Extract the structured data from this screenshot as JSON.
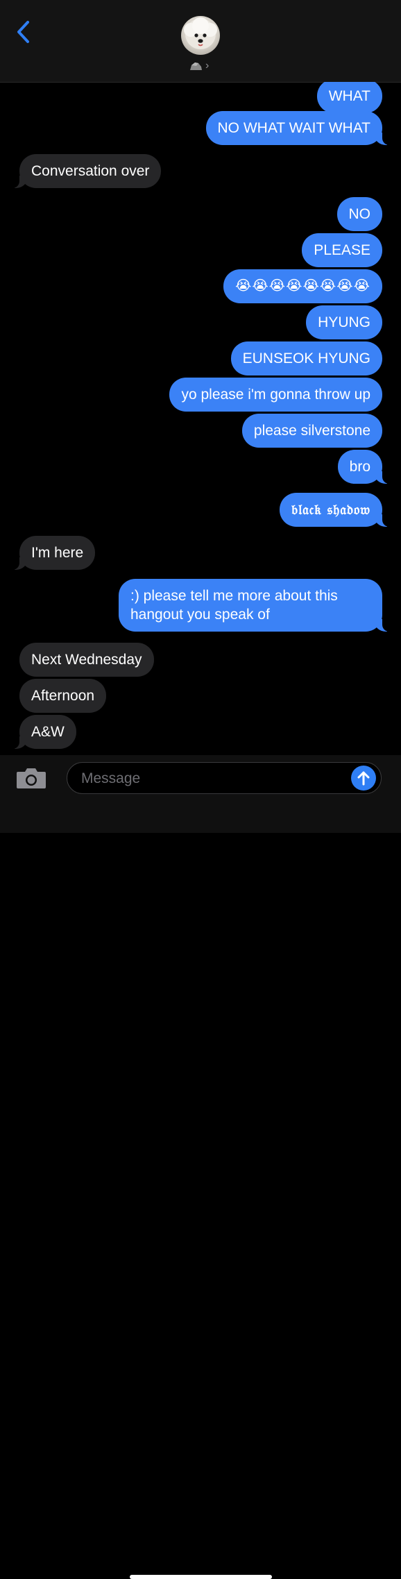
{
  "header": {
    "back_icon": "chevron-left-icon",
    "contact_avatar": "white-poodle-photo",
    "contact_emoji_icon": "rock-emoji-icon",
    "chevron_icon": "chevron-right-icon",
    "chevron_glyph": "›",
    "accent_color": "#2f7ff5"
  },
  "messages": [
    {
      "side": "sent",
      "text": "WHAT"
    },
    {
      "side": "sent",
      "text": "NO WHAT WAIT WHAT"
    },
    {
      "side": "received",
      "text": "Conversation over"
    },
    {
      "side": "sent",
      "text": "NO"
    },
    {
      "side": "sent",
      "text": "PLEASE"
    },
    {
      "side": "sent",
      "text": "😭😭😭😭😭😭😭😭"
    },
    {
      "side": "sent",
      "text": "HYUNG"
    },
    {
      "side": "sent",
      "text": "EUNSEOK HYUNG"
    },
    {
      "side": "sent",
      "text": "yo please i'm gonna throw up"
    },
    {
      "side": "sent",
      "text": "please silverstone"
    },
    {
      "side": "sent",
      "text": "bro"
    },
    {
      "side": "sent",
      "text": "𝔟𝔩𝔞𝔠𝔨 𝔰𝔥𝔞𝔡𝔬𝔴"
    },
    {
      "side": "received",
      "text": "I'm here"
    },
    {
      "side": "sent",
      "text": ":) please tell me more about this hangout you speak of"
    },
    {
      "side": "received",
      "text": "Next Wednesday"
    },
    {
      "side": "received",
      "text": "Afternoon"
    },
    {
      "side": "received",
      "text": "A&W"
    }
  ],
  "composer": {
    "camera_icon": "camera-icon",
    "placeholder": "Message",
    "send_icon": "arrow-up-icon"
  },
  "colors": {
    "sent_bubble": "#3b82f6",
    "received_bubble": "#262628",
    "background": "#000000"
  }
}
